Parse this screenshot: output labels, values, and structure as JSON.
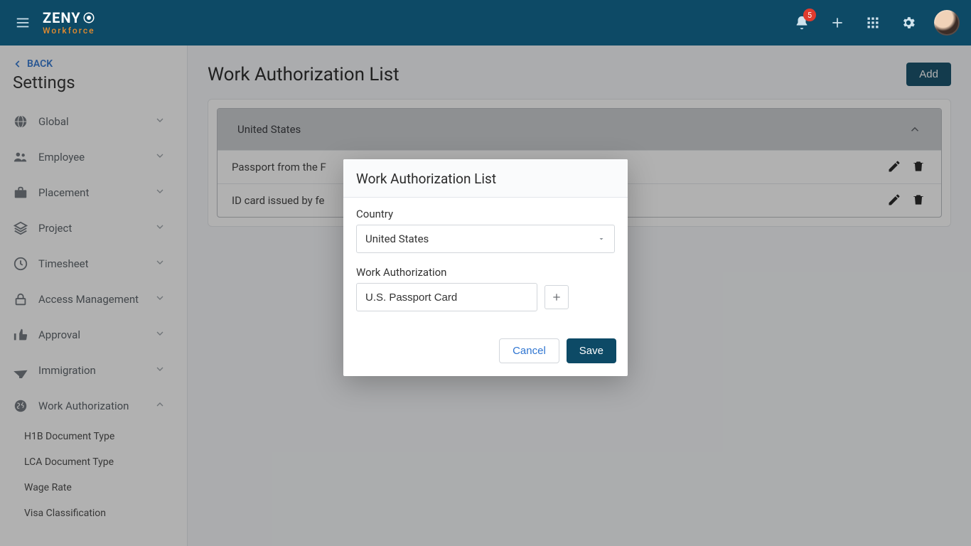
{
  "brand": {
    "main": "ZENY",
    "sub": "Workforce"
  },
  "topbar": {
    "notif_count": "5"
  },
  "sidebar": {
    "back_label": "BACK",
    "title": "Settings",
    "groups": [
      {
        "icon": "globe",
        "label": "Global",
        "open": false
      },
      {
        "icon": "people",
        "label": "Employee",
        "open": false
      },
      {
        "icon": "briefcase",
        "label": "Placement",
        "open": false
      },
      {
        "icon": "layers",
        "label": "Project",
        "open": false
      },
      {
        "icon": "clock",
        "label": "Timesheet",
        "open": false
      },
      {
        "icon": "lock",
        "label": "Access Management",
        "open": false
      },
      {
        "icon": "thumbs",
        "label": "Approval",
        "open": false
      },
      {
        "icon": "plane",
        "label": "Immigration",
        "open": false
      },
      {
        "icon": "earth",
        "label": "Work Authorization",
        "open": true,
        "children": [
          "H1B Document Type",
          "LCA Document Type",
          "Wage Rate",
          "Visa Classification"
        ]
      }
    ]
  },
  "page": {
    "title": "Work Authorization List",
    "add_label": "Add",
    "panel": {
      "country": "United States",
      "rows": [
        "Passport from the F",
        "ID card issued by fe"
      ]
    }
  },
  "modal": {
    "title": "Work Authorization List",
    "country_label": "Country",
    "country_value": "United States",
    "wa_label": "Work Authorization",
    "wa_value": "U.S. Passport Card",
    "cancel": "Cancel",
    "save": "Save"
  }
}
